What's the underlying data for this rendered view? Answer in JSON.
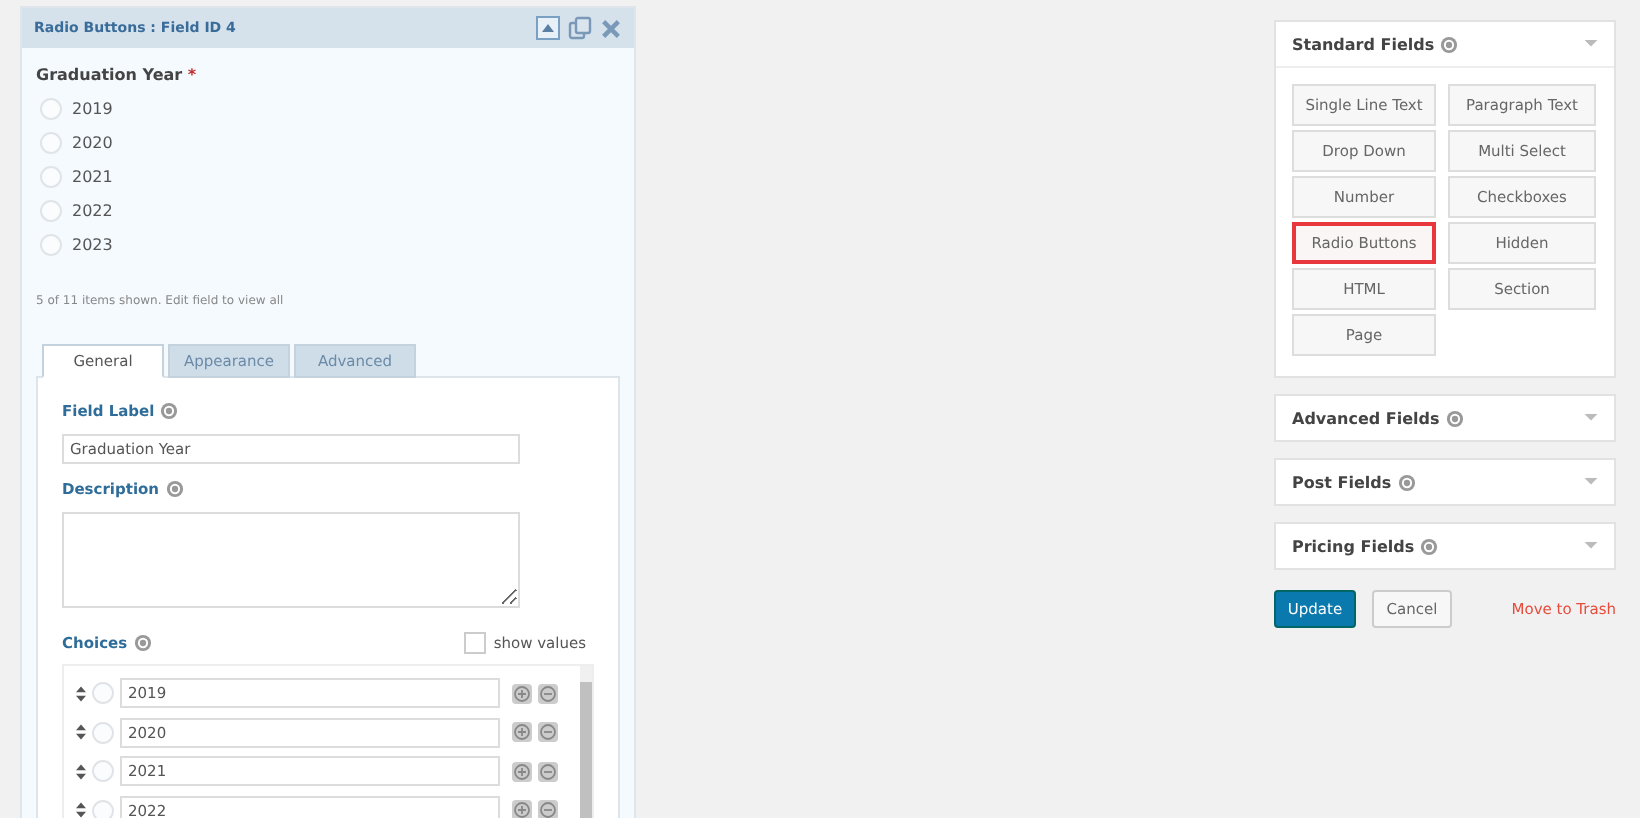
{
  "field_panel": {
    "title": "Radio Buttons : Field ID 4",
    "preview": {
      "label": "Graduation Year",
      "required_mark": "*",
      "options": [
        {
          "label": "2019",
          "selected": false
        },
        {
          "label": "2020",
          "selected": false
        },
        {
          "label": "2021",
          "selected": false
        },
        {
          "label": "2022",
          "selected": false
        },
        {
          "label": "2023",
          "selected": false
        }
      ],
      "note": "5 of 11 items shown. Edit field to view all"
    },
    "tabs": [
      {
        "label": "General",
        "selected": true
      },
      {
        "label": "Appearance",
        "selected": false
      },
      {
        "label": "Advanced",
        "selected": false
      }
    ],
    "field_label": {
      "label": "Field Label",
      "value": "Graduation Year"
    },
    "description": {
      "label": "Description"
    },
    "choices": {
      "label": "Choices",
      "show_values": {
        "label": "show values",
        "checked": false
      },
      "items": [
        {
          "value": "2019",
          "selected": false
        },
        {
          "value": "2020",
          "selected": false
        },
        {
          "value": "2021",
          "selected": false
        },
        {
          "value": "2022",
          "selected": false
        }
      ]
    }
  },
  "sidebar": {
    "sections": [
      {
        "title": "Standard Fields",
        "expanded": true,
        "buttons": [
          {
            "label": "Single Line Text",
            "highlighted": false
          },
          {
            "label": "Paragraph Text",
            "highlighted": false
          },
          {
            "label": "Drop Down",
            "highlighted": false
          },
          {
            "label": "Multi Select",
            "highlighted": false
          },
          {
            "label": "Number",
            "highlighted": false
          },
          {
            "label": "Checkboxes",
            "highlighted": false
          },
          {
            "label": "Radio Buttons",
            "highlighted": true
          },
          {
            "label": "Hidden",
            "highlighted": false
          },
          {
            "label": "HTML",
            "highlighted": false
          },
          {
            "label": "Section",
            "highlighted": false
          },
          {
            "label": "Page",
            "highlighted": false
          }
        ]
      },
      {
        "title": "Advanced Fields",
        "expanded": false
      },
      {
        "title": "Post Fields",
        "expanded": false
      },
      {
        "title": "Pricing Fields",
        "expanded": false
      }
    ],
    "actions": {
      "update": "Update",
      "cancel": "Cancel",
      "trash": "Move to Trash"
    }
  }
}
